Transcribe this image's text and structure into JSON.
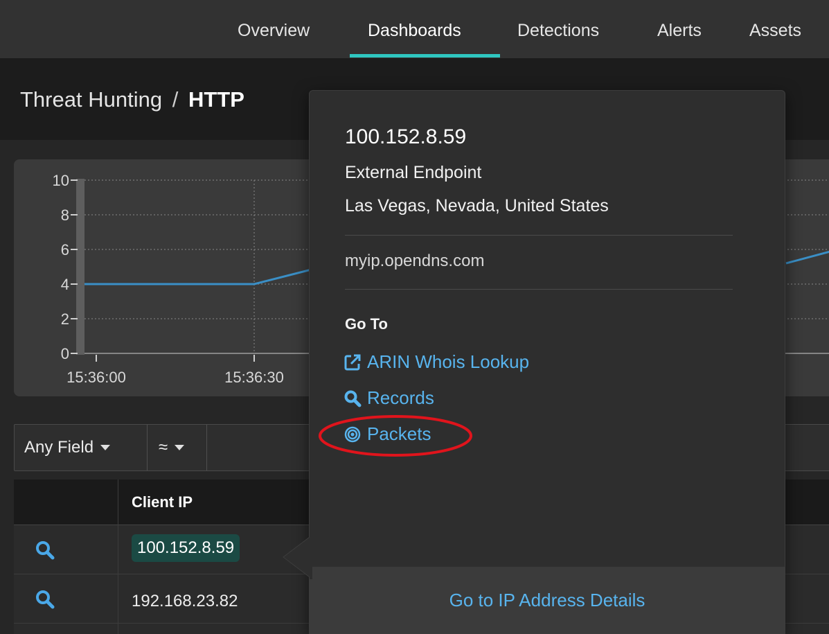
{
  "nav": {
    "items": [
      {
        "label": "Overview",
        "active": false
      },
      {
        "label": "Dashboards",
        "active": true
      },
      {
        "label": "Detections",
        "active": false
      },
      {
        "label": "Alerts",
        "active": false
      },
      {
        "label": "Assets",
        "active": false
      }
    ],
    "accent_color": "#2fc6c0"
  },
  "breadcrumb": {
    "parent": "Threat Hunting",
    "separator": "/",
    "current": "HTTP"
  },
  "chart_data": {
    "type": "line",
    "x": [
      "15:36:00",
      "15:36:30"
    ],
    "y_ticks": [
      0,
      2,
      4,
      6,
      8,
      10
    ],
    "ylim": [
      0,
      10
    ],
    "series": [
      {
        "values": [
          4,
          4
        ],
        "color": "#3a8fc6"
      }
    ],
    "grid": true
  },
  "filter": {
    "field_label": "Any Field",
    "operator_label": "≈"
  },
  "table": {
    "columns": [
      "Client IP"
    ],
    "rows": [
      {
        "client_ip": "100.152.8.59",
        "selected": true
      },
      {
        "client_ip": "192.168.23.82",
        "selected": false
      }
    ]
  },
  "popover": {
    "ip": "100.152.8.59",
    "endpoint_type": "External Endpoint",
    "location": "Las Vegas, Nevada, United States",
    "hostname": "myip.opendns.com",
    "goto_heading": "Go To",
    "links": [
      {
        "label": "ARIN Whois Lookup",
        "icon": "external-link-icon"
      },
      {
        "label": "Records",
        "icon": "search-icon"
      },
      {
        "label": "Packets",
        "icon": "target-icon",
        "highlighted": true
      }
    ],
    "footer_label": "Go to IP Address Details",
    "link_color": "#58b4ee",
    "highlight_color": "#e0141c"
  }
}
